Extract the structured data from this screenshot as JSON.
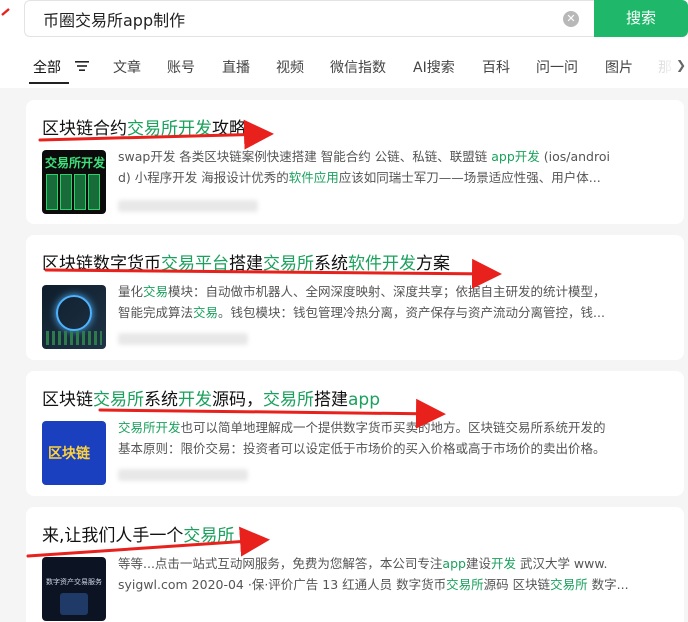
{
  "search": {
    "query": "币圈交易所app制作",
    "button_label": "搜索"
  },
  "tabs": [
    {
      "label": "全部",
      "active": true
    },
    {
      "label": "文章"
    },
    {
      "label": "账号"
    },
    {
      "label": "直播"
    },
    {
      "label": "视频"
    },
    {
      "label": "微信指数"
    },
    {
      "label": "AI搜索"
    },
    {
      "label": "百科"
    },
    {
      "label": "问一问"
    },
    {
      "label": "图片"
    },
    {
      "label": "那"
    }
  ],
  "results": [
    {
      "title_parts": [
        {
          "text": "区块链合约",
          "hl": false
        },
        {
          "text": "交易所开发",
          "hl": true
        },
        {
          "text": "攻略",
          "hl": false
        }
      ],
      "thumb_text": "交易所开发",
      "snippet_lines": [
        [
          {
            "text": "swap开发 各类区块链案例快速搭建 智能合约 公链、私链、联盟链 ",
            "hl": false
          },
          {
            "text": "app开发",
            "hl": true
          },
          {
            "text": " (ios/androi",
            "hl": false
          }
        ],
        [
          {
            "text": "d) 小程序开发 海报设计优秀的",
            "hl": false
          },
          {
            "text": "软件应用",
            "hl": true
          },
          {
            "text": "应该如同瑞士军刀——场景适应性强、用户体...",
            "hl": false
          }
        ]
      ]
    },
    {
      "title_parts": [
        {
          "text": "区块链数字货币",
          "hl": false
        },
        {
          "text": "交易平台",
          "hl": true
        },
        {
          "text": "搭建",
          "hl": false
        },
        {
          "text": "交易所",
          "hl": true
        },
        {
          "text": "系统",
          "hl": false
        },
        {
          "text": "软件开发",
          "hl": true
        },
        {
          "text": "方案",
          "hl": false
        }
      ],
      "thumb_text": "",
      "snippet_lines": [
        [
          {
            "text": "量化",
            "hl": false
          },
          {
            "text": "交易",
            "hl": true
          },
          {
            "text": "模块：自动做市机器人、全网深度映射、深度共享；依据自主研发的统计模型，",
            "hl": false
          }
        ],
        [
          {
            "text": "智能完成算法",
            "hl": false
          },
          {
            "text": "交易",
            "hl": true
          },
          {
            "text": "。钱包模块：钱包管理冷热分离，资产保存与资产流动分离管控，钱...",
            "hl": false
          }
        ]
      ]
    },
    {
      "title_parts": [
        {
          "text": "区块链",
          "hl": false
        },
        {
          "text": "交易所",
          "hl": true
        },
        {
          "text": "系统",
          "hl": false
        },
        {
          "text": "开发",
          "hl": true
        },
        {
          "text": "源码，",
          "hl": false
        },
        {
          "text": "交易所",
          "hl": true
        },
        {
          "text": "搭建",
          "hl": false
        },
        {
          "text": "app",
          "hl": true
        }
      ],
      "thumb_text": "区块链",
      "snippet_lines": [
        [
          {
            "text": "交易所开发",
            "hl": true
          },
          {
            "text": "也可以简单地理解成一个提供数字货币买卖的地方。区块链交易所系统开发的",
            "hl": false
          }
        ],
        [
          {
            "text": "基本原则：限价交易：投资者可以设定低于市场价的买入价格或高于市场价的卖出价格。",
            "hl": false
          }
        ]
      ]
    },
    {
      "title_parts": [
        {
          "text": "来,让我们人手一个",
          "hl": false
        },
        {
          "text": "交易所",
          "hl": true
        }
      ],
      "thumb_text": "数字资产交易服务",
      "snippet_lines": [
        [
          {
            "text": "等等...点击一站式互动网服务，免费为您解答，本公司专注",
            "hl": false
          },
          {
            "text": "app",
            "hl": true
          },
          {
            "text": "建设",
            "hl": false
          },
          {
            "text": "开发",
            "hl": true
          },
          {
            "text": " 武汉大学 www.",
            "hl": false
          }
        ],
        [
          {
            "text": "syigwl.com 2020-04 ·保·评价广告 13 红通人员 数字货币",
            "hl": false
          },
          {
            "text": "交易所",
            "hl": true
          },
          {
            "text": "源码 区块链",
            "hl": false
          },
          {
            "text": "交易所",
            "hl": true
          },
          {
            "text": " 数字...",
            "hl": false
          }
        ]
      ]
    }
  ],
  "colors": {
    "accent": "#1fb86a",
    "highlight": "#1aa15c",
    "annotation_arrow": "#e8211c"
  }
}
